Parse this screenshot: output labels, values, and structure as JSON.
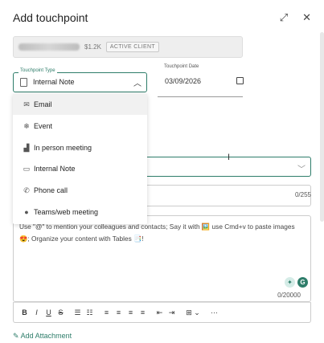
{
  "dialog": {
    "title": "Add touchpoint"
  },
  "client_bar": {
    "amount": "$1.2K",
    "badge": "ACTIVE CLIENT"
  },
  "touchpoint_type": {
    "label": "Touchpoint Type",
    "value": "Internal Note"
  },
  "touchpoint_date": {
    "label": "Touchpoint Date",
    "value": "03/09/2026"
  },
  "menu": {
    "items": [
      {
        "label": "Email",
        "icon": "mail-icon"
      },
      {
        "label": "Event",
        "icon": "event-icon"
      },
      {
        "label": "In person meeting",
        "icon": "building-icon"
      },
      {
        "label": "Internal Note",
        "icon": "note-icon"
      },
      {
        "label": "Phone call",
        "icon": "phone-icon"
      },
      {
        "label": "Teams/web meeting",
        "icon": "web-meeting-icon"
      }
    ]
  },
  "subject": {
    "counter": "0/255"
  },
  "editor": {
    "placeholder": "Use \"@\" to mention your colleagues and contacts; Say it with 🖼️ use Cmd+v to paste images 😍; Organize your content with Tables 📑!",
    "counter": "0/20000"
  },
  "toolbar": {
    "bold": "B",
    "italic": "I",
    "underline": "U",
    "strike": "S",
    "bullets": "☰",
    "numbers": "☷",
    "align_left": "≡",
    "align_center": "≡",
    "align_right": "≡",
    "justify": "≡",
    "outdent": "⇤",
    "indent": "⇥",
    "table": "⊞ ⌄",
    "more": "···"
  },
  "attachment": {
    "label": "Add Attachment"
  }
}
